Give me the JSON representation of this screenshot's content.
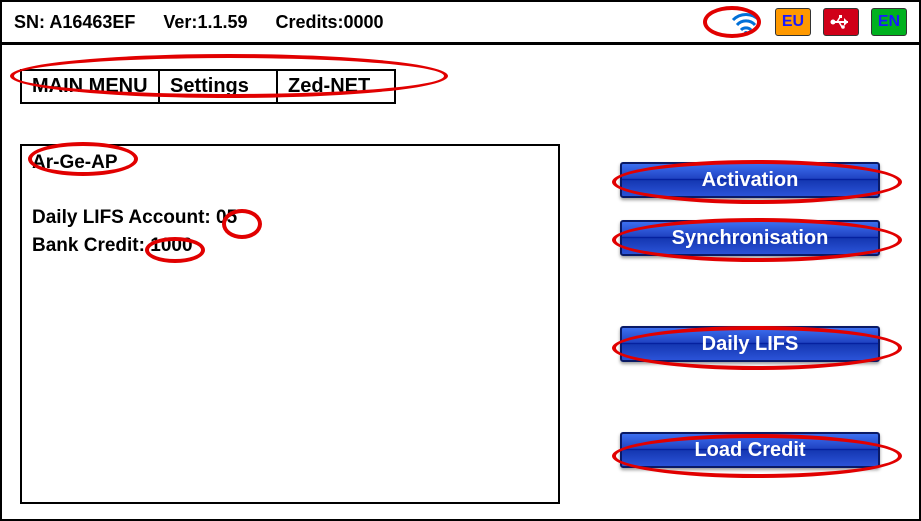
{
  "header": {
    "sn_label": "SN: ",
    "sn_value": "A16463EF",
    "ver_label": "Ver:",
    "ver_value": "1.1.59",
    "credits_label": "Credits:",
    "credits_value": "0000",
    "badge_eu": "EU",
    "badge_en": "EN"
  },
  "breadcrumb": {
    "items": [
      {
        "label": "MAIN MENU"
      },
      {
        "label": "Settings"
      },
      {
        "label": "Zed-NET"
      }
    ]
  },
  "panel": {
    "ap_name": "Ar-Ge-AP",
    "daily_lifs_label": "Daily LIFS Account: ",
    "daily_lifs_value": "05",
    "bank_credit_label": "Bank Credit: ",
    "bank_credit_value": "1000"
  },
  "buttons": {
    "activation": "Activation",
    "synchronisation": "Synchronisation",
    "daily_lifs": "Daily LIFS",
    "load_credit": "Load Credit"
  }
}
